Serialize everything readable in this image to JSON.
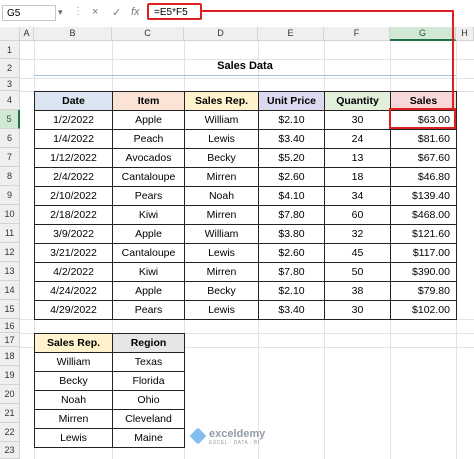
{
  "formula_bar": {
    "name_box": "G5",
    "cancel_icon": "×",
    "enter_icon": "✓",
    "fx_label": "fx",
    "formula": "=E5*F5"
  },
  "columns": [
    "A",
    "B",
    "C",
    "D",
    "E",
    "F",
    "G",
    "H"
  ],
  "rows": [
    "1",
    "2",
    "3",
    "4",
    "5",
    "6",
    "7",
    "8",
    "9",
    "10",
    "11",
    "12",
    "13",
    "14",
    "15",
    "16",
    "17",
    "18",
    "19",
    "20",
    "21",
    "22",
    "23"
  ],
  "selected_cell": "G5",
  "title": "Sales Data",
  "sales_table": {
    "headers": [
      "Date",
      "Item",
      "Sales Rep.",
      "Unit Price",
      "Quantity",
      "Sales"
    ],
    "rows": [
      [
        "1/2/2022",
        "Apple",
        "William",
        "$2.10",
        "30",
        "$63.00"
      ],
      [
        "1/4/2022",
        "Peach",
        "Lewis",
        "$3.40",
        "24",
        "$81.60"
      ],
      [
        "1/12/2022",
        "Avocados",
        "Becky",
        "$5.20",
        "13",
        "$67.60"
      ],
      [
        "2/4/2022",
        "Cantaloupe",
        "Mirren",
        "$2.60",
        "18",
        "$46.80"
      ],
      [
        "2/10/2022",
        "Pears",
        "Noah",
        "$4.10",
        "34",
        "$139.40"
      ],
      [
        "2/18/2022",
        "Kiwi",
        "Mirren",
        "$7.80",
        "60",
        "$468.00"
      ],
      [
        "3/9/2022",
        "Apple",
        "William",
        "$3.80",
        "32",
        "$121.60"
      ],
      [
        "3/21/2022",
        "Cantaloupe",
        "Lewis",
        "$2.60",
        "45",
        "$117.00"
      ],
      [
        "4/2/2022",
        "Kiwi",
        "Mirren",
        "$7.80",
        "50",
        "$390.00"
      ],
      [
        "4/24/2022",
        "Apple",
        "Becky",
        "$2.10",
        "38",
        "$79.80"
      ],
      [
        "4/29/2022",
        "Pears",
        "Lewis",
        "$3.40",
        "30",
        "$102.00"
      ]
    ]
  },
  "region_table": {
    "headers": [
      "Sales Rep.",
      "Region"
    ],
    "rows": [
      [
        "William",
        "Texas"
      ],
      [
        "Becky",
        "Florida"
      ],
      [
        "Noah",
        "Ohio"
      ],
      [
        "Mirren",
        "Cleveland"
      ],
      [
        "Lewis",
        "Maine"
      ]
    ]
  },
  "watermark": {
    "name": "exceldemy",
    "tagline": "EXCEL · DATA · BI"
  },
  "colors": {
    "highlight_red": "#e02020",
    "selection_green": "#217346"
  }
}
